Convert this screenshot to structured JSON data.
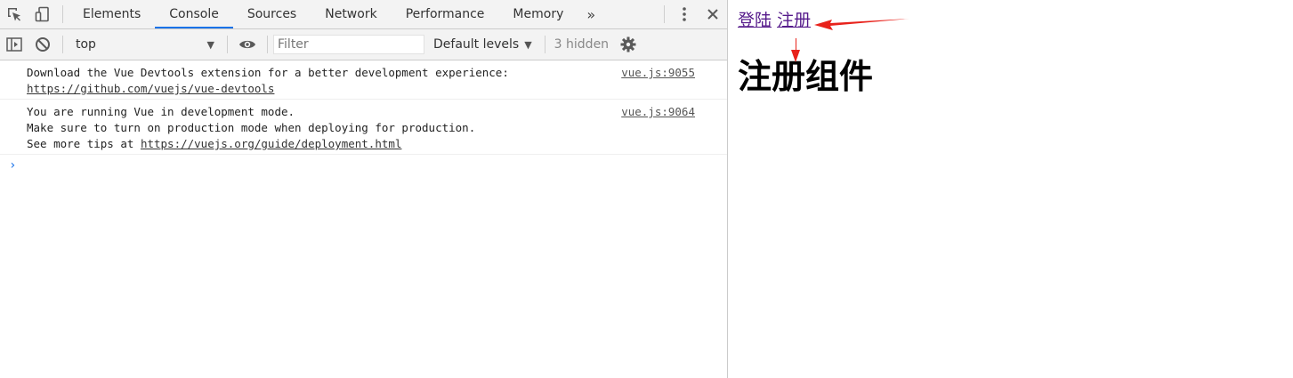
{
  "devtools": {
    "tabs": [
      {
        "label": "Elements"
      },
      {
        "label": "Console"
      },
      {
        "label": "Sources"
      },
      {
        "label": "Network"
      },
      {
        "label": "Performance"
      },
      {
        "label": "Memory"
      }
    ],
    "more_tabs": "»",
    "toolbar": {
      "context": "top",
      "filter_placeholder": "Filter",
      "filter_value": "",
      "levels": "Default levels",
      "hidden": "3 hidden"
    },
    "messages": [
      {
        "line1": "Download the Vue Devtools extension for a better development experience:",
        "link": "https://github.com/vuejs/vue-devtools",
        "source": "vue.js:9055"
      },
      {
        "line1": "You are running Vue in development mode.",
        "line2": "Make sure to turn on production mode when deploying for production.",
        "line3_prefix": "See more tips at ",
        "link": "https://vuejs.org/guide/deployment.html",
        "source": "vue.js:9064"
      }
    ],
    "prompt": "›"
  },
  "page": {
    "links": [
      {
        "label": "登陆"
      },
      {
        "label": "注册"
      }
    ],
    "heading": "注册组件"
  },
  "colors": {
    "accent": "#1a73e8",
    "visited_link": "#551a8b",
    "annotation_arrow": "#e8221b"
  }
}
